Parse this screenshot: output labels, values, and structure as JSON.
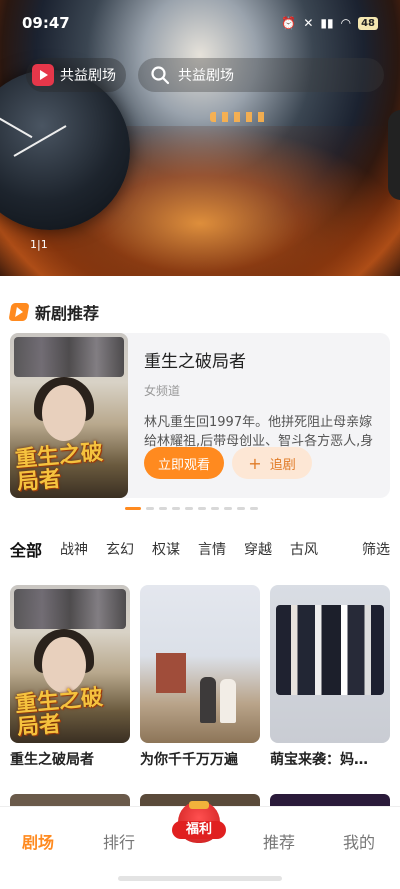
{
  "status_bar": {
    "time": "09:47",
    "battery": "48"
  },
  "header": {
    "logo_text": "共益剧场",
    "search_placeholder": "共益剧场"
  },
  "banner": {
    "page_indicator": "1|1"
  },
  "new_drama": {
    "section_title": "新剧推荐",
    "title": "重生之破局者",
    "genre": "女频道",
    "description": "林凡重生回1997年。他拼死阻止母亲嫁给林耀祖,后带母创业、智斗各方恶人,身体…",
    "cover_text": "重生之破局者",
    "watch_button": "立即观看",
    "follow_button": "追剧",
    "carousel_active_index": 0,
    "carousel_count": 10
  },
  "filters": {
    "items": [
      "全部",
      "战神",
      "玄幻",
      "权谋",
      "言情",
      "穿越",
      "古风"
    ],
    "active": "全部",
    "more": "筛选"
  },
  "dramas": [
    {
      "name": "重生之破局者"
    },
    {
      "name": "为你千千万万遍"
    },
    {
      "name": "萌宝来袭：妈…"
    }
  ],
  "tabbar": {
    "items": [
      "剧场",
      "排行",
      "福利",
      "推荐",
      "我的"
    ],
    "active": "剧场"
  },
  "colors": {
    "accent": "#ff8a1f",
    "follow_bg": "#fde7d5",
    "fuli_red": "#e02020"
  }
}
